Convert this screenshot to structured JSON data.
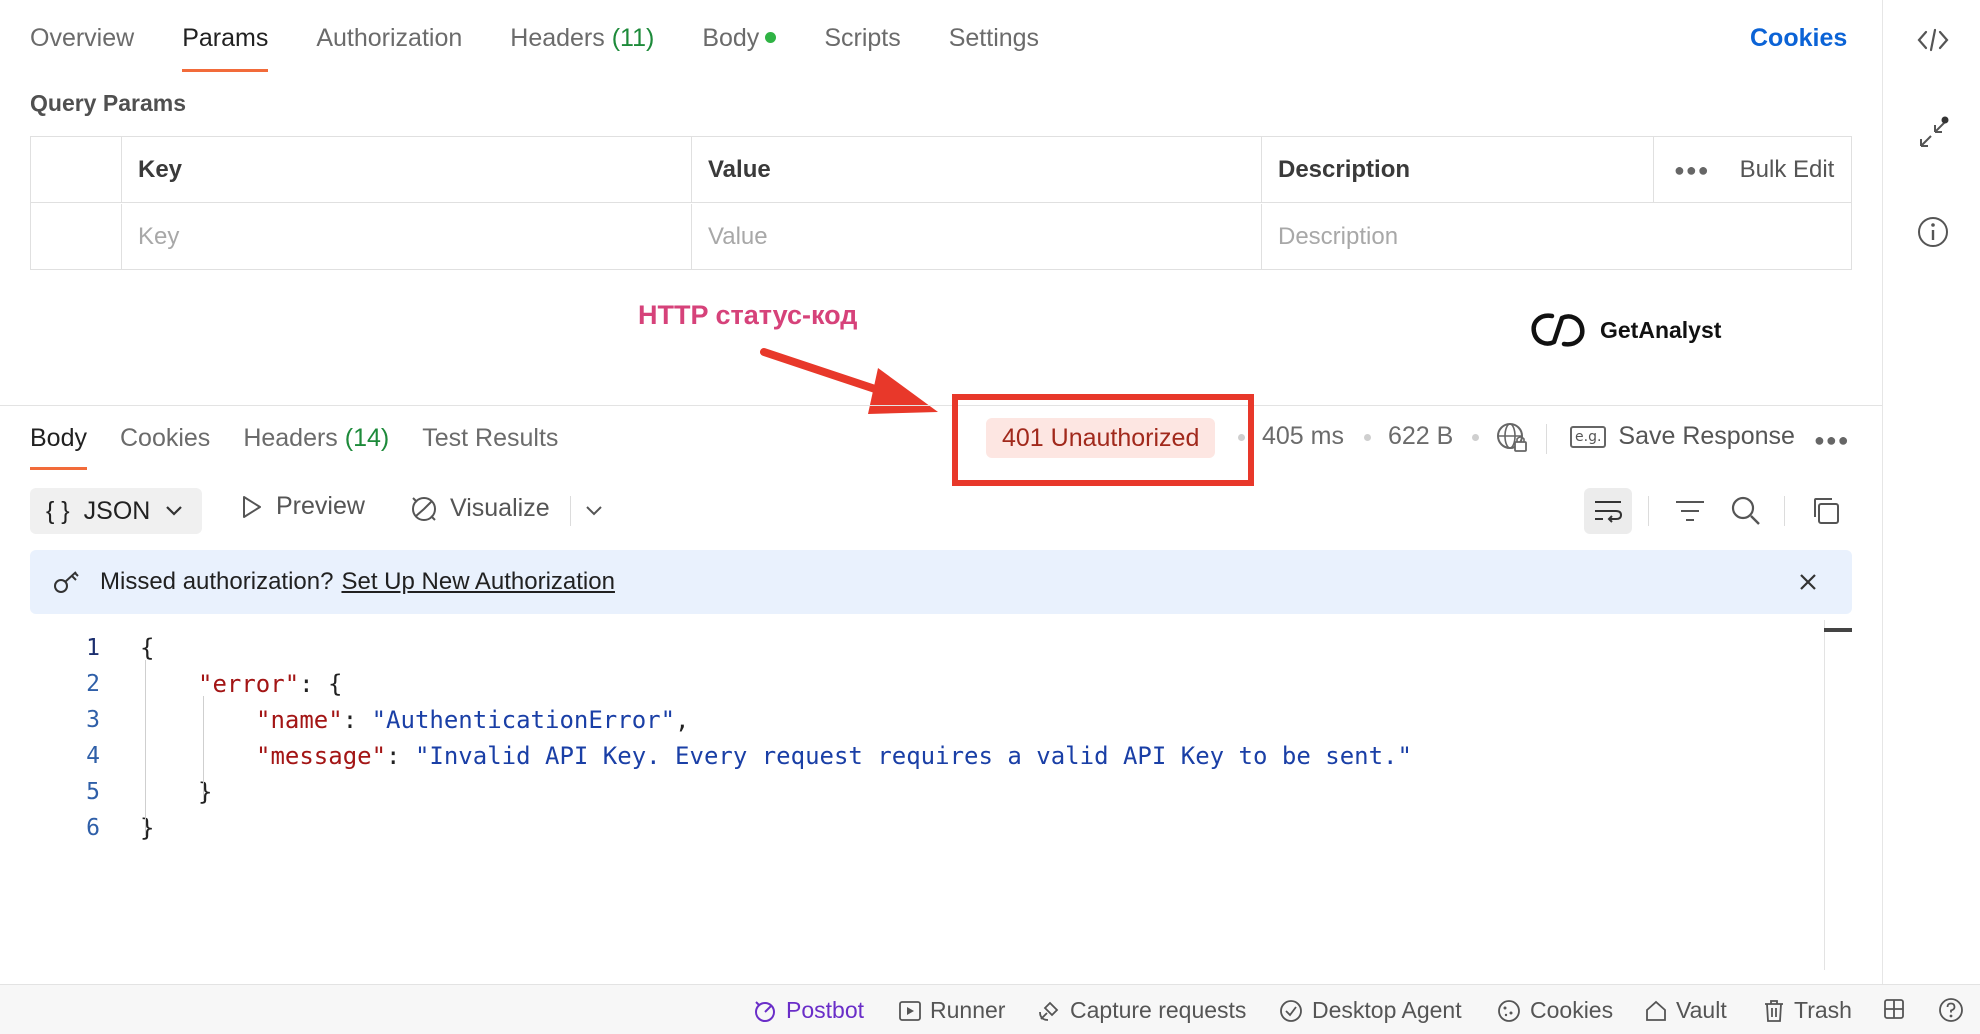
{
  "request_tabs": {
    "overview": "Overview",
    "params": "Params",
    "authorization": "Authorization",
    "headers": "Headers",
    "headers_count": "(11)",
    "body": "Body",
    "scripts": "Scripts",
    "settings": "Settings",
    "cookies": "Cookies"
  },
  "query_params": {
    "title": "Query Params",
    "columns": [
      "Key",
      "Value",
      "Description"
    ],
    "bulk_edit": "Bulk Edit",
    "placeholders": [
      "Key",
      "Value",
      "Description"
    ]
  },
  "annotation": {
    "label": "HTTP статус-код",
    "color": "#e8382a"
  },
  "logo": {
    "text": "GetAnalyst"
  },
  "response_tabs": {
    "body": "Body",
    "cookies": "Cookies",
    "headers": "Headers",
    "headers_count": "(14)",
    "test_results": "Test Results"
  },
  "response_meta": {
    "status": "401 Unauthorized",
    "time": "405 ms",
    "size": "622 B",
    "save_response": "Save Response",
    "eg_icon": "e.g."
  },
  "response_toolbar": {
    "format": "JSON",
    "format_icon": "{ }",
    "preview": "Preview",
    "visualize": "Visualize"
  },
  "banner": {
    "text": "Missed authorization?",
    "link": "Set Up New Authorization"
  },
  "code": {
    "line_numbers": [
      "1",
      "2",
      "3",
      "4",
      "5",
      "6"
    ],
    "brace_open": "{",
    "error_key": "\"error\"",
    "colon_brace": ": {",
    "name_key": "\"name\"",
    "name_value": "\"AuthenticationError\"",
    "message_key": "\"message\"",
    "message_value": "\"Invalid API Key. Every request requires a valid API Key to be sent.\"",
    "inner_close": "}",
    "brace_close": "}",
    "colon": ": ",
    "comma": ","
  },
  "footer": {
    "postbot": "Postbot",
    "runner": "Runner",
    "capture": "Capture requests",
    "desktop_agent": "Desktop Agent",
    "cookies": "Cookies",
    "vault": "Vault",
    "trash": "Trash"
  },
  "colors": {
    "accent": "#f26b3a",
    "link": "#0b63d6",
    "status_bg": "#fde6e2",
    "status_text": "#a1291c",
    "annotation_text": "#d6427a",
    "banner_bg": "#e9f1fd"
  }
}
